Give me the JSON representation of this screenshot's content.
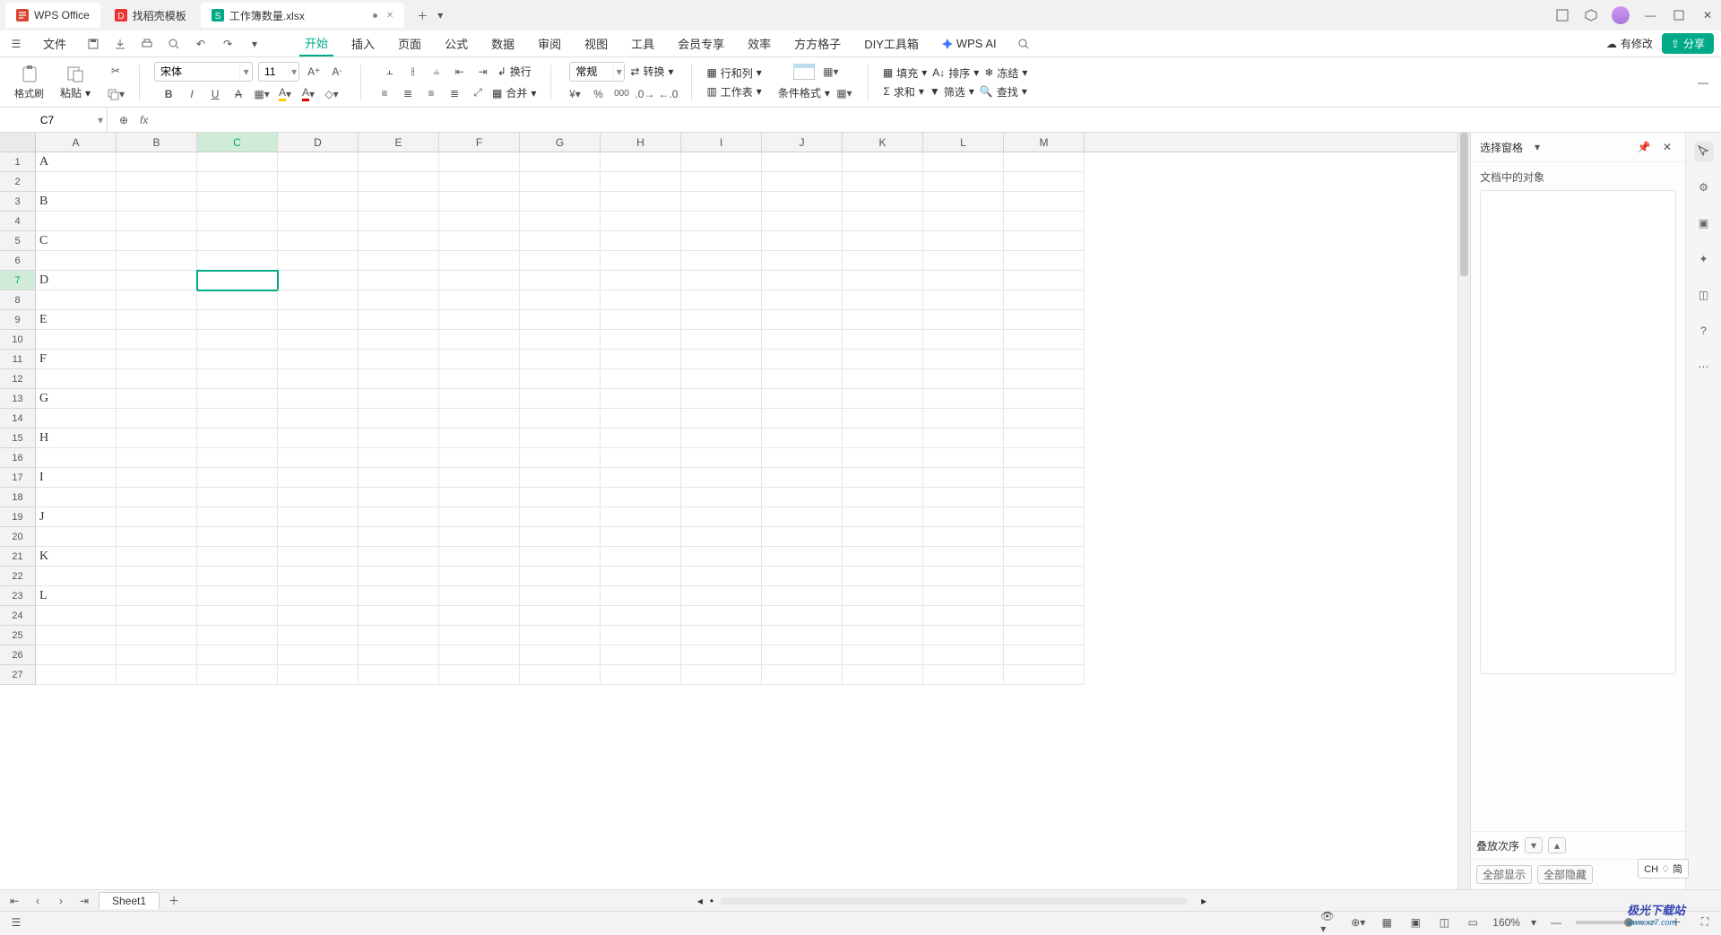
{
  "titlebar": {
    "app_tab": "WPS Office",
    "template_tab": "找稻壳模板",
    "doc_tab": "工作簿数量.xlsx",
    "modified_indicator": "●"
  },
  "menubar": {
    "file": "文件",
    "items": [
      "开始",
      "插入",
      "页面",
      "公式",
      "数据",
      "审阅",
      "视图",
      "工具",
      "会员专享",
      "效率",
      "方方格子",
      "DIY工具箱"
    ],
    "ai": "WPS AI",
    "modify": "有修改",
    "share": "分享"
  },
  "ribbon": {
    "format_painter": "格式刷",
    "paste": "粘贴",
    "font_name": "宋体",
    "font_size": "11",
    "wrap": "换行",
    "merge": "合并",
    "number_format": "常规",
    "convert": "转换",
    "rowcol": "行和列",
    "worksheet": "工作表",
    "cond_format": "条件格式",
    "fill": "填充",
    "sort": "排序",
    "freeze": "冻结",
    "sum": "求和",
    "filter": "筛选",
    "find": "查找"
  },
  "namebox": {
    "ref": "C7"
  },
  "formula_bar": {
    "fx": "fx",
    "value": ""
  },
  "columns": [
    "A",
    "B",
    "C",
    "D",
    "E",
    "F",
    "G",
    "H",
    "I",
    "J",
    "K",
    "L",
    "M"
  ],
  "row_count": 27,
  "selected": {
    "col": "C",
    "row": 7
  },
  "cells": {
    "1": {
      "A": "A"
    },
    "3": {
      "A": "B"
    },
    "5": {
      "A": "C"
    },
    "7": {
      "A": "D"
    },
    "9": {
      "A": "E"
    },
    "11": {
      "A": "F"
    },
    "13": {
      "A": "G"
    },
    "15": {
      "A": "H"
    },
    "17": {
      "A": "I"
    },
    "19": {
      "A": "J"
    },
    "21": {
      "A": "K"
    },
    "23": {
      "A": "L"
    }
  },
  "right_pane": {
    "title": "选择窗格",
    "subtitle": "文档中的对象",
    "stack_order": "叠放次序",
    "show_all": "全部显示",
    "hide_all": "全部隐藏"
  },
  "sheet_tabs": {
    "sheet1": "Sheet1"
  },
  "statusbar": {
    "zoom": "160%",
    "ime": "CH ♢ 简"
  },
  "watermark": {
    "l1": "极光下载站",
    "l2": "www.xz7.com"
  }
}
